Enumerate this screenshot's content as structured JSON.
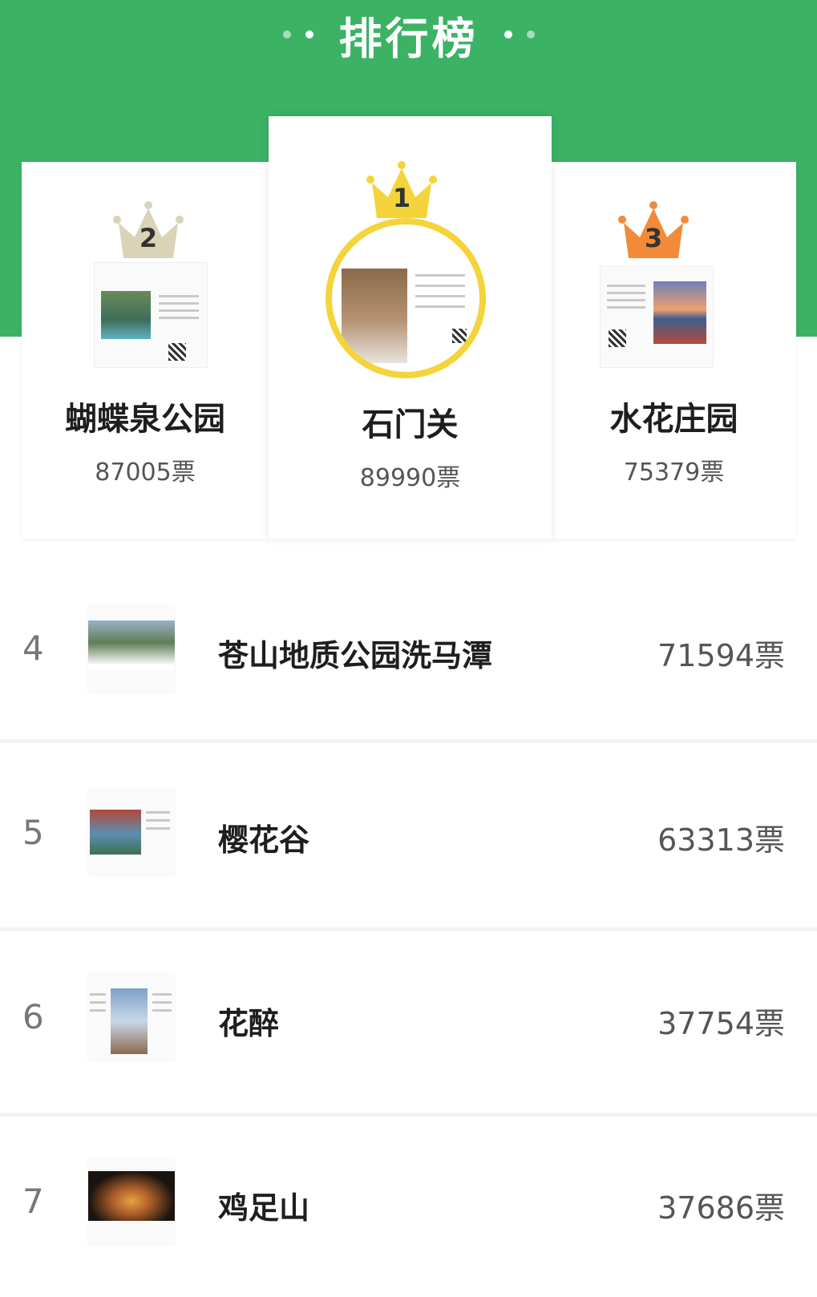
{
  "header": {
    "title": "排行榜"
  },
  "colors": {
    "brand_green": "#3cb264",
    "gold": "#f4d43a",
    "silver": "#d9d3b8",
    "bronze": "#f28a3a"
  },
  "podium": [
    {
      "rank": "2",
      "name": "蝴蝶泉公园",
      "votes": "87005票",
      "crown_color": "silver"
    },
    {
      "rank": "1",
      "name": "石门关",
      "votes": "89990票",
      "crown_color": "gold"
    },
    {
      "rank": "3",
      "name": "水花庄园",
      "votes": "75379票",
      "crown_color": "bronze"
    }
  ],
  "list": [
    {
      "rank": "4",
      "name": "苍山地质公园洗马潭",
      "votes": "71594票"
    },
    {
      "rank": "5",
      "name": "樱花谷",
      "votes": "63313票"
    },
    {
      "rank": "6",
      "name": "花醉",
      "votes": "37754票"
    },
    {
      "rank": "7",
      "name": "鸡足山",
      "votes": "37686票"
    }
  ]
}
